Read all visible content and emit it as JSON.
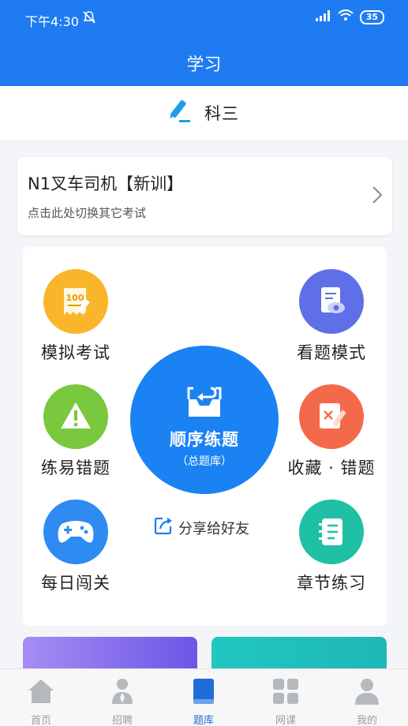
{
  "status_bar": {
    "time": "下午4:30",
    "battery": "35"
  },
  "header": {
    "title": "学习"
  },
  "subject": {
    "label": "科三"
  },
  "exam": {
    "title": "N1叉车司机【新训】",
    "subtitle": "点击此处切换其它考试"
  },
  "tiles": [
    {
      "label": "模拟考试",
      "icon": "exam-100-icon",
      "color": "#fbb52a"
    },
    {
      "label": "看题模式",
      "icon": "eye-document-icon",
      "color": "#5f6fe8"
    },
    {
      "label": "练易错题",
      "icon": "warning-icon",
      "color": "#79c83d"
    },
    {
      "label": "收藏 · 错题",
      "icon": "wrong-pen-icon",
      "color": "#f5694b"
    },
    {
      "label": "每日闯关",
      "icon": "gamepad-icon",
      "color": "#2d8bf2"
    },
    {
      "label": "章节练习",
      "icon": "notebook-icon",
      "color": "#1fc0a4"
    }
  ],
  "center": {
    "title": "顺序练题",
    "subtitle": "（总题库）"
  },
  "share": {
    "label": "分享给好友"
  },
  "tabbar": [
    {
      "label": "首页",
      "icon": "home-icon",
      "active": false
    },
    {
      "label": "招聘",
      "icon": "recruit-person-icon",
      "active": false
    },
    {
      "label": "题库",
      "icon": "book-icon",
      "active": true
    },
    {
      "label": "网课",
      "icon": "grid-apps-icon",
      "active": false
    },
    {
      "label": "我的",
      "icon": "user-icon",
      "active": false
    }
  ],
  "colors": {
    "primary": "#1f7bf2",
    "tab_active": "#1f6ed8",
    "tab_inactive": "#9aa0a6"
  }
}
